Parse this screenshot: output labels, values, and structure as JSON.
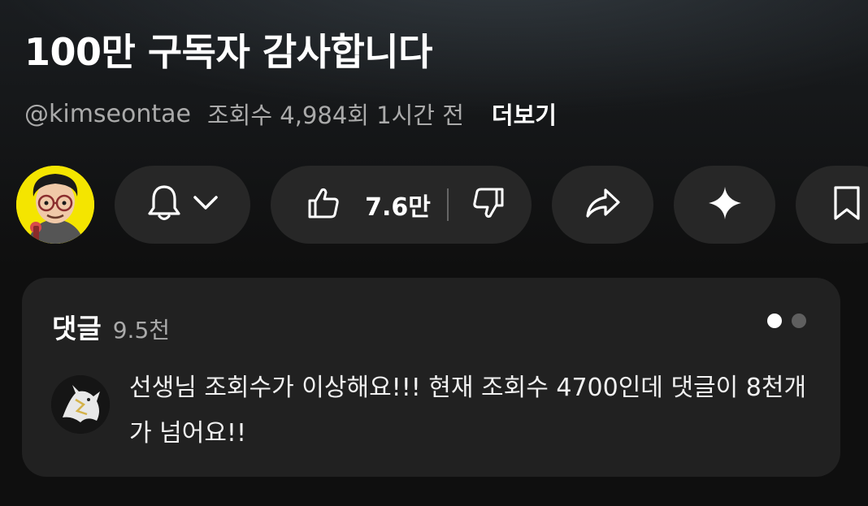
{
  "video": {
    "title": "100만 구독자 감사합니다",
    "channel_handle": "@kimseontae",
    "views_time": "조회수 4,984회 1시간 전",
    "more_label": "더보기"
  },
  "actions": {
    "like_count": "7.6만"
  },
  "comments": {
    "label": "댓글",
    "count": "9.5천",
    "top_comment": "선생님 조회수가 이상해요!!! 현재 조회수 4700인데 댓글이 8천개가 넘어요!!"
  },
  "colors": {
    "background": "#0f0f0f",
    "pill": "#272727",
    "comment_card": "#212121",
    "secondary_text": "#aaaaaa",
    "avatar_bg": "#f4e500"
  },
  "icons": {
    "subscribe": "bell-icon",
    "subscribe_menu": "chevron-down-icon",
    "like": "thumbs-up-icon",
    "dislike": "thumbs-down-icon",
    "share": "share-arrow-icon",
    "ask": "sparkle-icon",
    "save": "bookmark-icon"
  }
}
